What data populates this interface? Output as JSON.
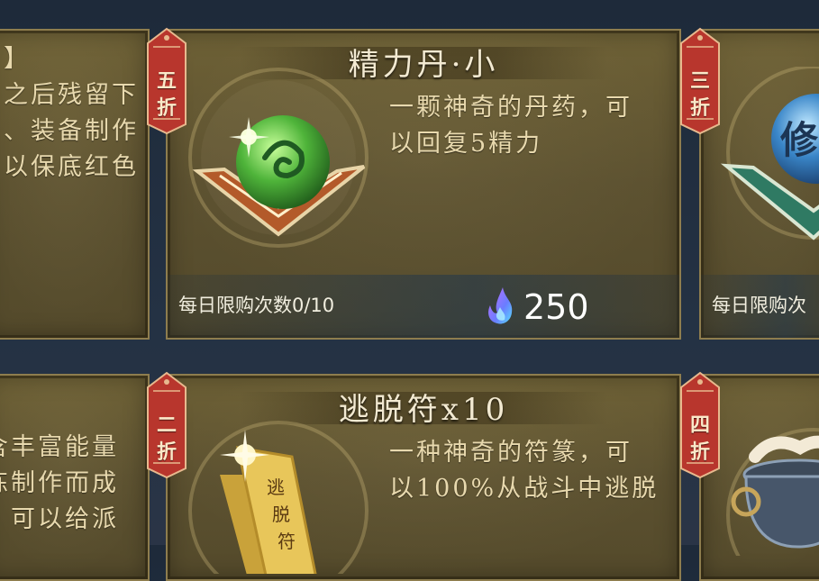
{
  "cards": [
    {
      "title": "",
      "desc": "】\n之后残留下\n、装备制作\n以保底红色",
      "limit": ""
    },
    {
      "title": "精力丹·小",
      "discount": [
        "五",
        "折"
      ],
      "desc": "一颗神奇的丹药，可\n以回复5精力",
      "limit": "每日限购次数0/10",
      "price": "250",
      "item_icon": "green-spirit-pill-icon"
    },
    {
      "title": "",
      "discount": [
        "三",
        "折"
      ],
      "limit": "每日限购次",
      "item_icon": "blue-repair-orb-icon",
      "orb_text": "修"
    },
    {
      "title": "",
      "desc": "含丰富能量\n炼制作而成\n，可以给派"
    },
    {
      "title": "逃脱符x10",
      "discount": [
        "二",
        "折"
      ],
      "desc": "一种神奇的符篆，可\n以100%从战斗中逃脱",
      "item_icon": "escape-talisman-icon",
      "talisman_text": [
        "逃",
        "脱",
        "符"
      ]
    },
    {
      "title": "",
      "discount": [
        "四",
        "折"
      ],
      "item_icon": "cauldron-icon"
    }
  ],
  "colors": {
    "card_bg": "#5c5130",
    "tag_red": "#b8362d",
    "text_light": "#e8d9ae"
  }
}
